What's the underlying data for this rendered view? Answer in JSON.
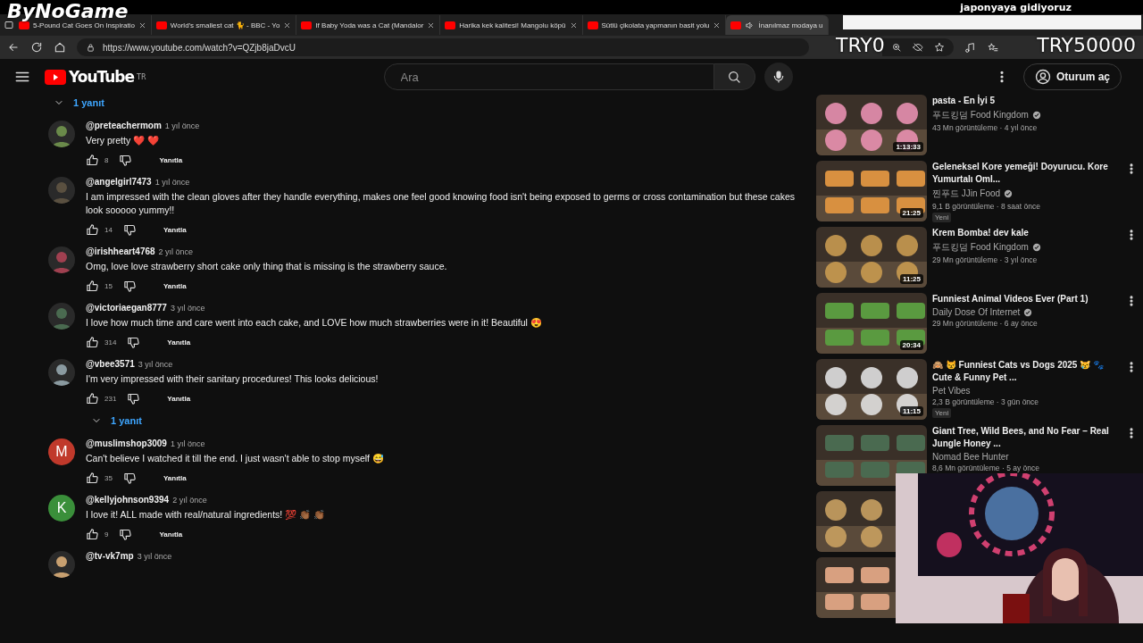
{
  "stream_overlay": {
    "logo": "ByNoGame",
    "headline": "japonyaya gidiyoruz",
    "goal_current": "TRY0",
    "goal_target": "TRY50000"
  },
  "tabs": [
    {
      "title": "5-Pound Cat Goes On Inspiratio",
      "selected": false,
      "audio": false
    },
    {
      "title": "World's smallest cat 🐈 - BBC - Yo",
      "selected": false,
      "audio": false
    },
    {
      "title": "If Baby Yoda was a Cat (Mandalor",
      "selected": false,
      "audio": false
    },
    {
      "title": "Harika kek kalitesi! Mangolu köpü",
      "selected": false,
      "audio": false
    },
    {
      "title": "Sütlü çikolata yapmanın basit yolu",
      "selected": false,
      "audio": false
    },
    {
      "title": "İnanılmaz modaya u",
      "selected": true,
      "audio": true
    }
  ],
  "address_bar": {
    "url": "https://www.youtube.com/watch?v=QZjb8jaDvcU"
  },
  "header": {
    "logo": "YouTube",
    "region": "TR",
    "search": {
      "placeholder": "Ara"
    },
    "sign_in": "Oturum aç"
  },
  "top_replies_link": "1 yanıt",
  "comments": [
    {
      "handle": "@preteachermom",
      "time": "1 yıl önce",
      "text": "Very pretty ❤️ ❤️",
      "likes": "8",
      "reply": "Yanıtla",
      "avatar": {
        "kind": "picture"
      }
    },
    {
      "handle": "@angelgirl7473",
      "time": "1 yıl önce",
      "text": "I am impressed with the clean gloves after they handle everything, makes one feel good knowing food isn't being exposed to germs or cross contamination but these cakes look sooooo yummy!!",
      "likes": "14",
      "reply": "Yanıtla",
      "avatar": {
        "kind": "picture"
      }
    },
    {
      "handle": "@irishheart4768",
      "time": "2 yıl önce",
      "text": "Omg, love love strawberry short cake only thing that is missing is the strawberry sauce.",
      "likes": "15",
      "reply": "Yanıtla",
      "avatar": {
        "kind": "picture"
      }
    },
    {
      "handle": "@victoriaegan8777",
      "time": "3 yıl önce",
      "text": "I love how much time and care went into each cake, and LOVE how much strawberries were in it! Beautiful 😍",
      "likes": "314",
      "reply": "Yanıtla",
      "avatar": {
        "kind": "picture"
      }
    },
    {
      "handle": "@vbee3571",
      "time": "3 yıl önce",
      "text": "I'm very impressed with their sanitary procedures!  This looks delicious!",
      "likes": "231",
      "reply": "Yanıtla",
      "replies": "1 yanıt",
      "avatar": {
        "kind": "picture"
      }
    },
    {
      "handle": "@muslimshop3009",
      "time": "1 yıl önce",
      "text": "Can't believe I watched it till the end. I just wasn't able to stop myself 😅",
      "likes": "35",
      "reply": "Yanıtla",
      "avatar": {
        "kind": "letter",
        "letter": "M",
        "color": "#c0392b"
      }
    },
    {
      "handle": "@kellyjohnson9394",
      "time": "2 yıl önce",
      "text": "I love it! ALL made with real/natural ingredients! 💯 👏🏾 👏🏾",
      "likes": "9",
      "reply": "Yanıtla",
      "avatar": {
        "kind": "letter",
        "letter": "K",
        "color": "#3a8f3a"
      }
    },
    {
      "handle": "@tv-vk7mp",
      "time": "3 yıl önce",
      "avatar": {
        "kind": "picture"
      }
    }
  ],
  "related": [
    {
      "title": "pasta - En İyi 5",
      "channel": "푸드킹덤 Food Kingdom",
      "verified": true,
      "meta": "43 Mn görüntüleme · 4 yıl önce",
      "duration": "1:13:33",
      "thumb": {
        "kind": "picture"
      }
    },
    {
      "title": "Geleneksel Kore yemeği! Doyurucu. Kore Yumurtalı Oml...",
      "channel": "찐푸드 JJin Food",
      "verified": true,
      "meta": "9,1 B görüntüleme · 8 saat önce",
      "badge": "Yeni",
      "duration": "21:25",
      "thumb": {
        "kind": "picture"
      }
    },
    {
      "title": "Krem Bomba! dev kale",
      "channel": "푸드킹덤 Food Kingdom",
      "verified": true,
      "meta": "29 Mn görüntüleme · 3 yıl önce",
      "duration": "11:25",
      "thumb": {
        "kind": "picture"
      }
    },
    {
      "title": "Funniest Animal Videos Ever (Part 1)",
      "channel": "Daily Dose Of Internet",
      "verified": true,
      "meta": "29 Mn görüntüleme · 6 ay önce",
      "duration": "20:34",
      "thumb": {
        "kind": "picture"
      }
    },
    {
      "title": "🙈 😾 Funniest Cats vs Dogs 2025 😿 🐾 Cute & Funny Pet ...",
      "channel": "Pet Vibes",
      "verified": false,
      "meta": "2,3 B görüntüleme · 3 gün önce",
      "badge": "Yeni",
      "duration": "11:15",
      "thumb": {
        "kind": "picture"
      }
    },
    {
      "title": "Giant Tree, Wild Bees, and No Fear – Real Jungle Honey ...",
      "channel": "Nomad Bee Hunter",
      "verified": false,
      "meta": "8,6 Mn görüntüleme · 5 ay önce",
      "thumb": {
        "kind": "picture"
      }
    },
    {
      "thumb": {
        "kind": "picture"
      }
    },
    {
      "thumb": {
        "kind": "picture"
      }
    }
  ],
  "webcam": {
    "kind": "picture"
  }
}
